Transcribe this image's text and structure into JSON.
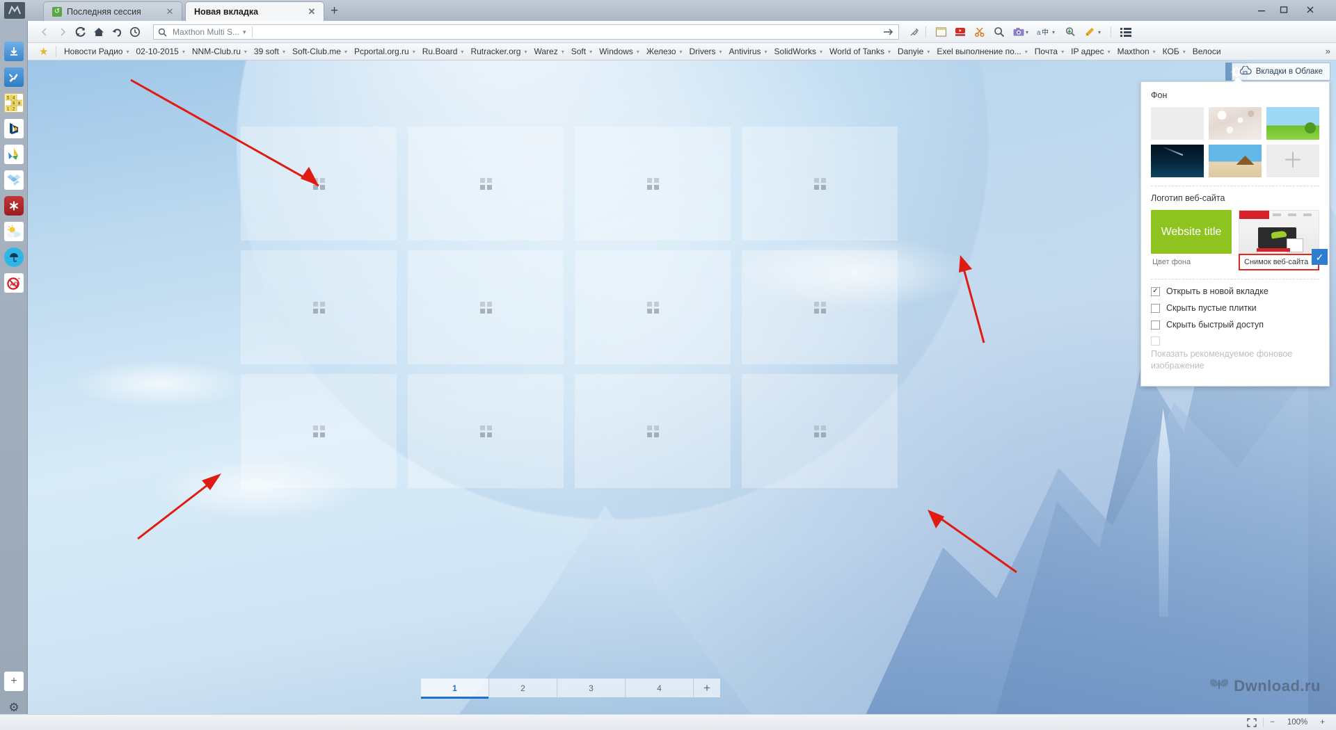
{
  "window": {
    "logo_icon": "maxthon-logo-icon",
    "minimize_label": "—",
    "maximize_label": "□",
    "close_label": "✕"
  },
  "tabs": [
    {
      "title": "Последняя сессия",
      "favicon": "restore-session-icon",
      "close": "✕",
      "active": false
    },
    {
      "title": "Новая вкладка",
      "favicon": "",
      "close": "✕",
      "active": true
    }
  ],
  "new_tab_button": "+",
  "nav": {
    "back_icon": "back-arrow-icon",
    "forward_icon": "forward-arrow-icon",
    "reload_icon": "reload-icon",
    "home_icon": "home-icon",
    "undo_icon": "undo-icon",
    "history_icon": "history-clock-icon"
  },
  "address_bar": {
    "search_icon": "search-icon",
    "engine_label": "Maxthon Multi S...",
    "engine_caret": "▾",
    "value": "",
    "placeholder": "",
    "go_icon": "go-arrow-icon"
  },
  "toolbar_icons": [
    {
      "name": "syringe-icon",
      "glyph": "💉"
    },
    {
      "name": "notepad-icon",
      "glyph": ""
    },
    {
      "name": "youtube-download-icon",
      "glyph": ""
    },
    {
      "name": "snip-scissors-icon",
      "glyph": ""
    },
    {
      "name": "find-magnifier-icon",
      "glyph": ""
    },
    {
      "name": "screenshot-camera-icon",
      "glyph": ""
    },
    {
      "name": "translate-icon",
      "glyph": ""
    },
    {
      "name": "resource-sniffer-icon",
      "glyph": ""
    },
    {
      "name": "skin-brush-icon",
      "glyph": ""
    },
    {
      "name": "more-tools-icon",
      "glyph": "▾"
    },
    {
      "name": "main-menu-icon",
      "glyph": ""
    }
  ],
  "bookmarks": {
    "star_icon": "bookmark-star-icon",
    "overflow_label": "»",
    "items": [
      "Новости Радио",
      "02-10-2015",
      "NNM-Club.ru",
      "39 soft",
      "Soft-Club.me",
      "Pcportal.org.ru",
      "Ru.Board",
      "Rutracker.org",
      "Warez",
      "Soft",
      "Windows",
      "Железо",
      "Drivers",
      "Antivirus",
      "SolidWorks",
      "World of Tanks",
      "Danyie",
      "Exel выполнение по...",
      "Почта",
      "IP адрес",
      "Maxthon",
      "КОБ",
      "Велоси"
    ],
    "caret": "▾"
  },
  "sidebar": {
    "items": [
      {
        "name": "download-icon",
        "glyph": "⬇"
      },
      {
        "name": "tools-icon",
        "glyph": "🔧"
      },
      {
        "name": "sudoku-icon",
        "glyph": ""
      },
      {
        "name": "bing-icon",
        "glyph": "b"
      },
      {
        "name": "recycle-icon",
        "glyph": ""
      },
      {
        "name": "dropbox-icon",
        "glyph": ""
      },
      {
        "name": "asterisk-icon",
        "glyph": "✱"
      },
      {
        "name": "weather-icon",
        "glyph": "☀"
      },
      {
        "name": "umbrella-icon",
        "glyph": "☂"
      },
      {
        "name": "adblock-icon",
        "glyph": "AD"
      }
    ],
    "bottom": [
      {
        "name": "add-panel-icon",
        "glyph": "+"
      },
      {
        "name": "settings-gear-icon",
        "glyph": "⚙"
      }
    ]
  },
  "newtab": {
    "gear_button": {
      "name": "newtab-settings-gear",
      "glyph": "⚙"
    },
    "cloud_tabs_button": {
      "label": "Вкладки в Облаке",
      "icon": "cloud-icon"
    },
    "tiles_count": 12,
    "tile_placeholder_icon": "empty-tile-grid-icon",
    "pagination": {
      "pages": [
        "1",
        "2",
        "3",
        "4"
      ],
      "active_index": 0,
      "add_page_label": "+"
    }
  },
  "settings_popup": {
    "background_section": {
      "title": "Фон",
      "thumbs": [
        {
          "name": "background-thumb-plain",
          "kind": "plain"
        },
        {
          "name": "background-thumb-spring",
          "kind": "spring"
        },
        {
          "name": "background-thumb-hills",
          "kind": "hills"
        },
        {
          "name": "background-thumb-night",
          "kind": "night"
        },
        {
          "name": "background-thumb-beach",
          "kind": "beach"
        },
        {
          "name": "background-thumb-add",
          "kind": "add",
          "glyph": "＋"
        }
      ]
    },
    "logo_section": {
      "title": "Логотип веб-сайта",
      "option_color": {
        "preview_text": "Website title",
        "caption": "Цвет фона",
        "selected": false
      },
      "option_snapshot": {
        "caption": "Снимок веб-сайта",
        "selected": true,
        "check_glyph": "✓"
      }
    },
    "options": [
      {
        "label": "Открыть в новой вкладке",
        "checked": true,
        "disabled": false
      },
      {
        "label": "Скрыть пустые плитки",
        "checked": false,
        "disabled": false
      },
      {
        "label": "Скрыть быстрый доступ",
        "checked": false,
        "disabled": false
      },
      {
        "label": "Показать рекомендуемое фоновое изображение",
        "checked": false,
        "disabled": true
      }
    ],
    "check_glyph": "✓"
  },
  "annotations": {
    "arrow_color": "#e01b12",
    "count": 4
  },
  "watermark": {
    "text": "Dwnload.ru",
    "icon": "butterfly-icon"
  },
  "statusbar": {
    "fullscreen_icon": "fullscreen-icon",
    "zoom_out": "−",
    "zoom_level": "100%",
    "zoom_in": "+"
  },
  "colors": {
    "accent_blue": "#1f6fd0",
    "annotation_red": "#e01b12",
    "logo_green": "#8ec320",
    "check_blue": "#2e7dd1"
  }
}
